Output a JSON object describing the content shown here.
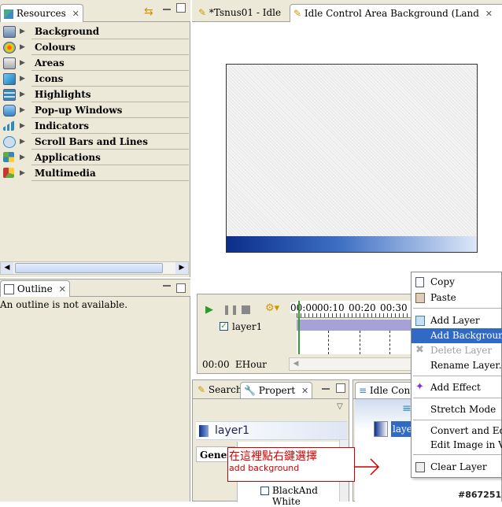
{
  "resources": {
    "tab_label": "Resources",
    "items": [
      {
        "label": "Background",
        "icon": "background-icon"
      },
      {
        "label": "Colours",
        "icon": "palette-icon"
      },
      {
        "label": "Areas",
        "icon": "areas-icon"
      },
      {
        "label": "Icons",
        "icon": "icons-icon"
      },
      {
        "label": "Highlights",
        "icon": "highlight-icon"
      },
      {
        "label": "Pop-up Windows",
        "icon": "popup-icon"
      },
      {
        "label": "Indicators",
        "icon": "signal-bars-icon"
      },
      {
        "label": "Scroll Bars and Lines",
        "icon": "scrollbar-icon"
      },
      {
        "label": "Applications",
        "icon": "applications-icon"
      },
      {
        "label": "Multimedia",
        "icon": "multimedia-icon"
      }
    ]
  },
  "outline": {
    "tab_label": "Outline",
    "empty_message": "An outline is not available."
  },
  "editor": {
    "tabs": [
      {
        "label": "*Tsnus01 - Idle"
      },
      {
        "label": "Idle Control Area Background (Land"
      }
    ]
  },
  "timeline": {
    "ticks": [
      "00:00",
      "00:10",
      "00:20",
      "00:30"
    ],
    "layer_name": "layer1",
    "time": "00:00",
    "unit": "EHour"
  },
  "properties": {
    "tabs": [
      {
        "label": "Search"
      },
      {
        "label": "Propert"
      }
    ],
    "layer_title": "layer1",
    "general_tab": "Gener",
    "checkbox_label": "BlackAnd White"
  },
  "idle_control": {
    "tab_label": "Idle Contro",
    "item_label": "layer"
  },
  "annotation": {
    "line1": "在這裡點右鍵選擇",
    "line2": "add background",
    "color": "#cc0000"
  },
  "context_menu": {
    "items": [
      {
        "label": "Copy",
        "state": "normal"
      },
      {
        "label": "Paste",
        "state": "normal"
      },
      {
        "label": "Add Layer",
        "state": "normal"
      },
      {
        "label": "Add Background",
        "state": "selected"
      },
      {
        "label": "Delete Layer",
        "state": "disabled"
      },
      {
        "label": "Rename Layer..",
        "state": "normal"
      },
      {
        "label": "Add Effect",
        "state": "normal"
      },
      {
        "label": "Stretch Mode",
        "state": "normal"
      },
      {
        "label": "Convert and Edit in",
        "state": "normal"
      },
      {
        "label": "Edit Image in Vecto",
        "state": "normal"
      },
      {
        "label": "Clear Layer",
        "state": "normal"
      }
    ]
  },
  "watermark": "#867251",
  "colors": {
    "accent": "#316ac5",
    "panel": "#ece9d8"
  }
}
